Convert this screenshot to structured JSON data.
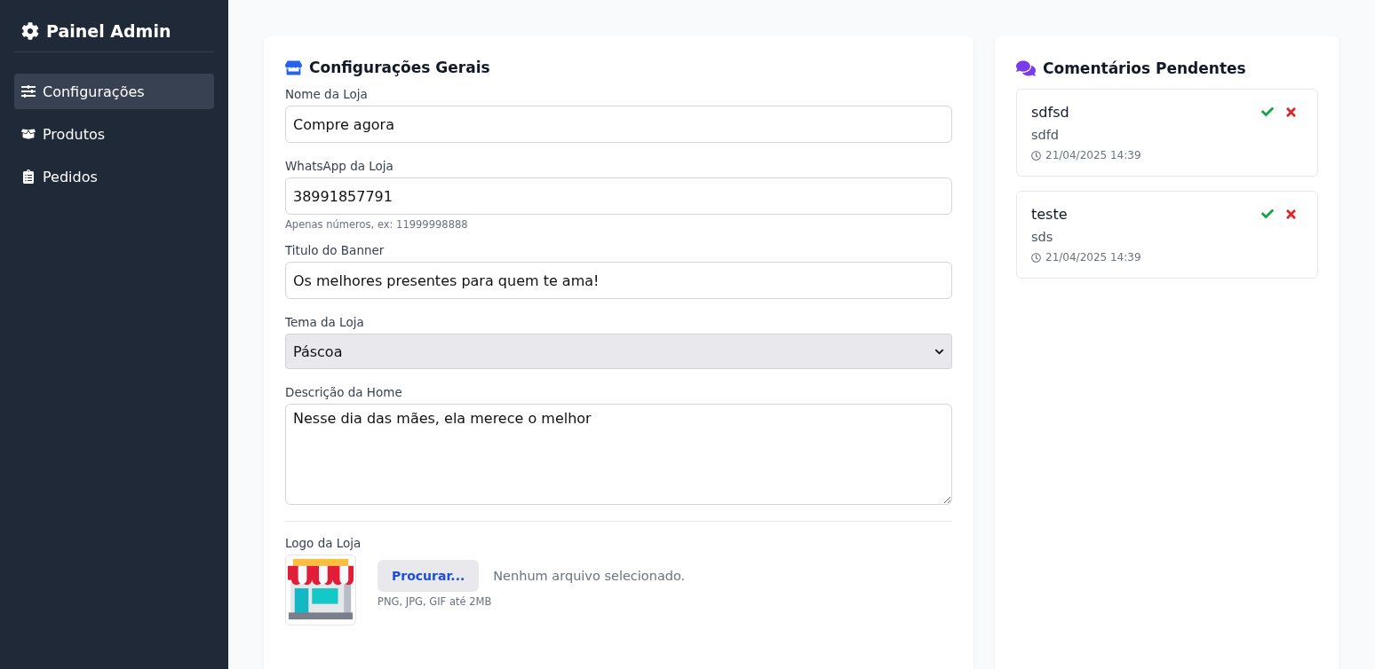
{
  "sidebar": {
    "title": "Painel Admin",
    "items": [
      {
        "label": "Configurações",
        "selected": true
      },
      {
        "label": "Produtos",
        "selected": false
      },
      {
        "label": "Pedidos",
        "selected": false
      }
    ]
  },
  "settings": {
    "title": "Configurações Gerais",
    "fields": [
      {
        "kind": "input",
        "label": "Nome da Loja",
        "value": "Compre agora"
      },
      {
        "kind": "input",
        "label": "WhatsApp da Loja",
        "value": "38991857791",
        "hint": "Apenas números, ex: 11999998888"
      },
      {
        "kind": "input",
        "label": "Titulo do Banner",
        "value": "Os melhores presentes para quem te ama!"
      },
      {
        "kind": "select",
        "label": "Tema da Loja",
        "value": "Páscoa"
      },
      {
        "kind": "textarea",
        "label": "Descrição da Home",
        "value": "Nesse dia das mães, ela merece o melhor"
      }
    ],
    "logo": {
      "label": "Logo da Loja",
      "button": "Procurar...",
      "status": "Nenhum arquivo selecionado.",
      "hint": "PNG, JPG, GIF até 2MB"
    }
  },
  "comments": {
    "title": "Comentários Pendentes",
    "items": [
      {
        "author": "sdfsd",
        "text": "sdfd",
        "date": "21/04/2025 14:39"
      },
      {
        "author": "teste",
        "text": "sds",
        "date": "21/04/2025 14:39"
      }
    ]
  }
}
